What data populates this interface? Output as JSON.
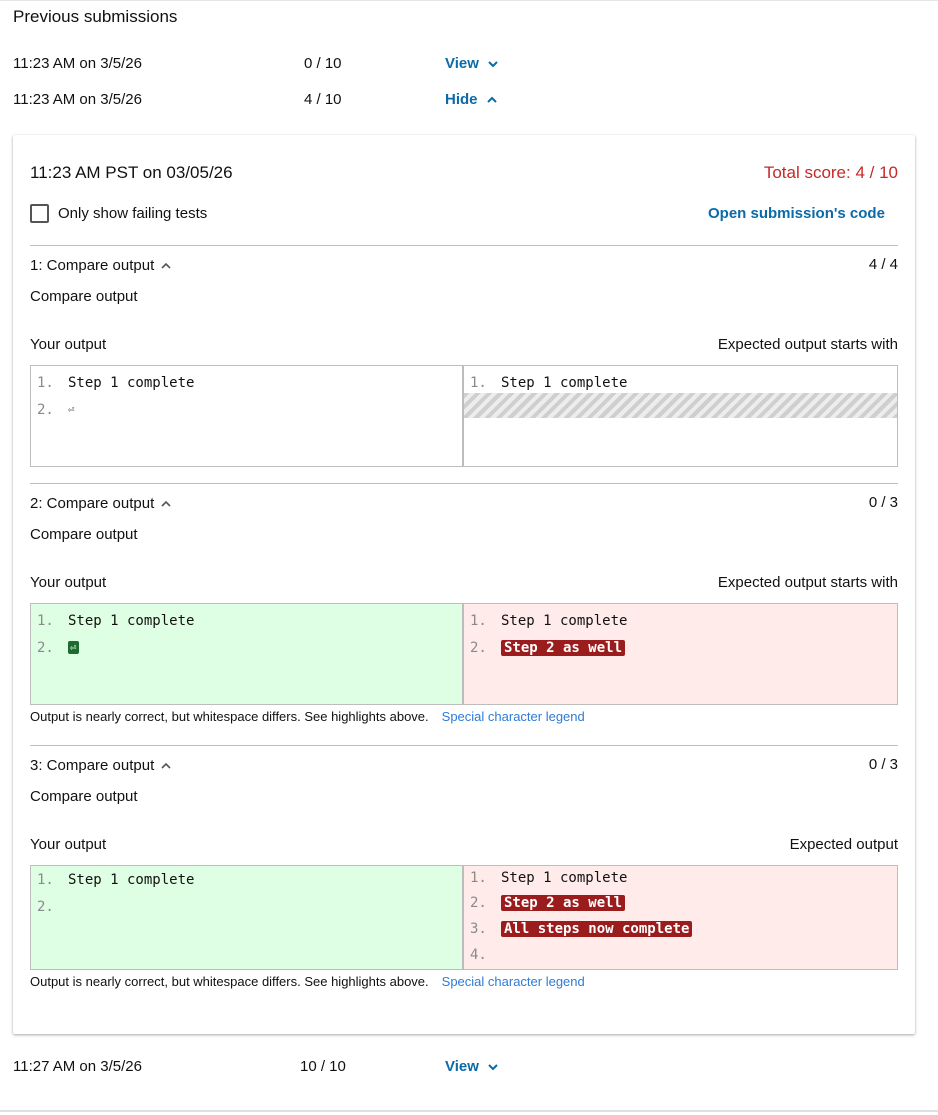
{
  "title": "Previous submissions",
  "submissions": [
    {
      "time": "11:23 AM on 3/5/26",
      "score": "0 / 10",
      "toggle": "View"
    },
    {
      "time": "11:23 AM on 3/5/26",
      "score": "4 / 10",
      "toggle": "Hide"
    },
    {
      "time": "11:27 AM on 3/5/26",
      "score": "10 / 10",
      "toggle": "View"
    }
  ],
  "card": {
    "timestamp": "11:23 AM PST on 03/05/26",
    "total_score": "Total score: 4 / 10",
    "failing_label": "Only show failing tests",
    "open_code": "Open submission's code",
    "tests": [
      {
        "title": "1: Compare output",
        "score": "4 / 4",
        "desc": "Compare output",
        "your_label": "Your output",
        "expected_label": "Expected output starts with",
        "your_lines": [
          {
            "num": "1.",
            "text": "Step 1 complete"
          },
          {
            "num": "2.",
            "text": "⏎"
          }
        ],
        "expected_lines": [
          {
            "num": "1.",
            "text": "Step 1 complete"
          }
        ]
      },
      {
        "title": "2: Compare output",
        "score": "0 / 3",
        "desc": "Compare output",
        "your_label": "Your output",
        "expected_label": "Expected output starts with",
        "your_lines": [
          {
            "num": "1.",
            "text": "Step 1 complete"
          },
          {
            "num": "2.",
            "text": "⏎"
          }
        ],
        "expected_lines": [
          {
            "num": "1.",
            "text": "Step 1 complete"
          },
          {
            "num": "2.",
            "text": "Step 2 as well"
          }
        ],
        "note": "Output is nearly correct, but whitespace differs. See highlights above.",
        "legend": "Special character legend"
      },
      {
        "title": "3: Compare output",
        "score": "0 / 3",
        "desc": "Compare output",
        "your_label": "Your output",
        "expected_label": "Expected output",
        "your_lines": [
          {
            "num": "1.",
            "text": "Step 1 complete"
          },
          {
            "num": "2.",
            "text": ""
          }
        ],
        "expected_lines": [
          {
            "num": "1.",
            "text": "Step 1 complete"
          },
          {
            "num": "2.",
            "text": "Step 2 as well"
          },
          {
            "num": "3.",
            "text": "All steps now complete"
          },
          {
            "num": "4.",
            "text": ""
          }
        ],
        "note": "Output is nearly correct, but whitespace differs. See highlights above.",
        "legend": "Special character legend"
      }
    ]
  },
  "icons": {
    "expand": "chevron-down-icon",
    "collapse": "chevron-up-icon"
  },
  "colors": {
    "link": "#0b6aa8",
    "score_red": "#c62828",
    "added_bg": "#dfffe4",
    "missing_bg": "#ffebea",
    "diff_red": "#9b1c1c",
    "diff_green": "#1e6b2e"
  }
}
